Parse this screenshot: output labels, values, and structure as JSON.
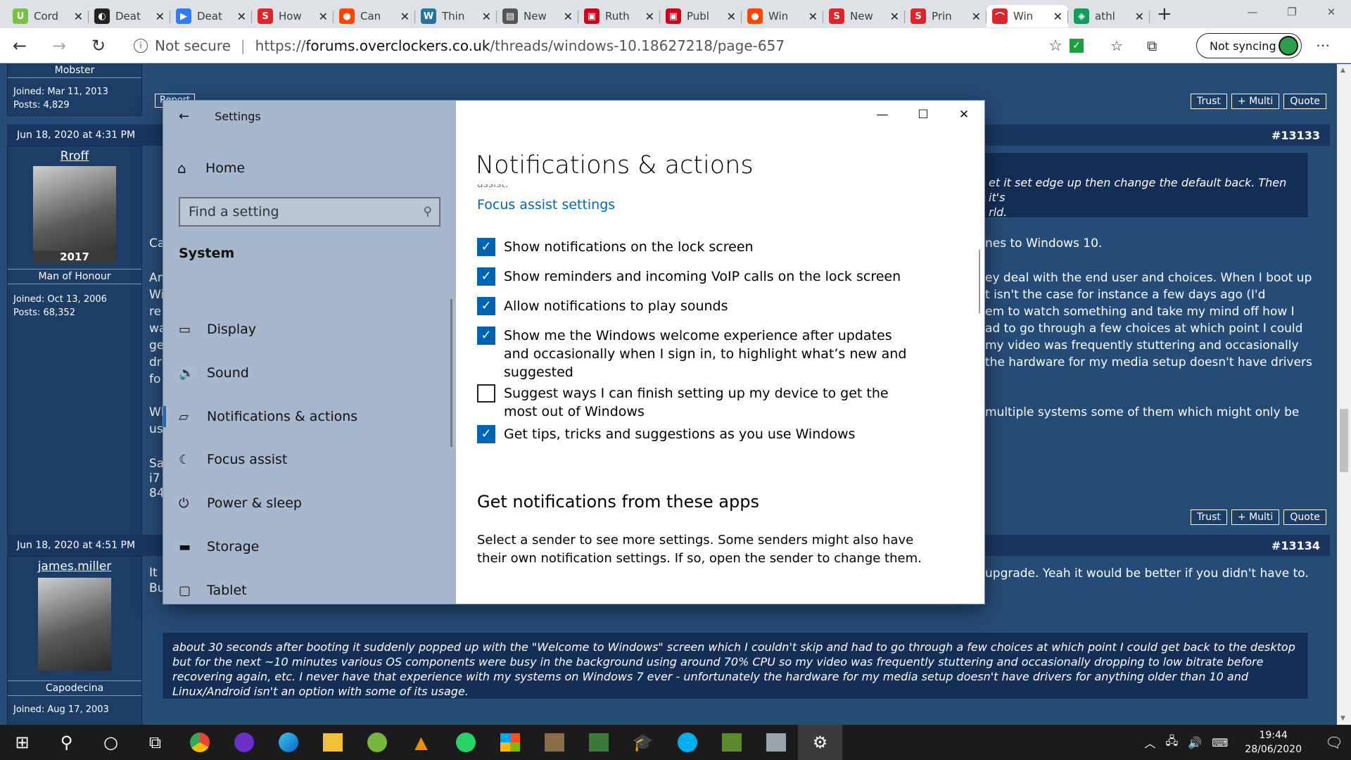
{
  "browser": {
    "tabs": [
      {
        "label": "Cord",
        "icon": "U",
        "color": "#7ac043"
      },
      {
        "label": "Deat",
        "icon": "◐",
        "color": "#222222"
      },
      {
        "label": "Deat",
        "icon": "▶",
        "color": "#2d7cf6"
      },
      {
        "label": "How",
        "icon": "S",
        "color": "#e0242b"
      },
      {
        "label": "Can",
        "icon": "●",
        "color": "#ff4500"
      },
      {
        "label": "Thin",
        "icon": "W",
        "color": "#21759b"
      },
      {
        "label": "New",
        "icon": "▤",
        "color": "#555555"
      },
      {
        "label": "Ruth",
        "icon": "▣",
        "color": "#d0021b"
      },
      {
        "label": "Publ",
        "icon": "▣",
        "color": "#d0021b"
      },
      {
        "label": "Win",
        "icon": "●",
        "color": "#ff4500"
      },
      {
        "label": "New",
        "icon": "S",
        "color": "#e0242b"
      },
      {
        "label": "Prin",
        "icon": "S",
        "color": "#e0242b"
      },
      {
        "label": "Win",
        "icon": "⌒",
        "color": "#e0242b"
      },
      {
        "label": "athl",
        "icon": "◈",
        "color": "#0f9d58"
      }
    ],
    "not_secure": "Not secure",
    "url_prefix": "https://",
    "url_host": "forums.overclockers.co.uk",
    "url_path": "/threads/windows-10.18627218/page-657",
    "sync_label": "Not syncing"
  },
  "forum": {
    "top_user": {
      "rank": "Mobster",
      "joined": "Joined: Mar 11, 2013",
      "posts": "Posts: 4,829",
      "report": "Report"
    },
    "buttons": {
      "trust": "Trust",
      "multi": "+ Multi",
      "quote": "Quote"
    },
    "post1": {
      "date": "Jun 18, 2020 at 4:31 PM",
      "number": "#13133",
      "user": "Rroff",
      "avatar_badge": "2017",
      "rank": "Man of Honour",
      "joined": "Joined: Oct 13, 2006",
      "posts": "Posts: 68,352",
      "quote_text": "et it set edge up then change the default back. Then it's\nrld.",
      "left_fragments": [
        "Ca",
        "An\nWi\nre\nwa\nge\ndr\nfo",
        "Wl\nus",
        "Sa\ni7\n84"
      ],
      "right_lines": [
        "nes to Windows 10.",
        "ey deal with the end user and choices. When I boot up\nt isn't the case for instance a few days ago (I'd\nem to watch something and take my mind off how I\nad to go through a few choices at which point I could\nmy video was frequently stuttering and occasionally\nthe hardware for my media setup doesn't have drivers",
        "multiple systems some of them which might only be"
      ]
    },
    "post2": {
      "date": "Jun 18, 2020 at 4:51 PM",
      "number": "#13134",
      "user": "james.miller",
      "rank": "Capodecina",
      "joined": "Joined: Aug 17, 2003",
      "left_fragment": "It\nBu",
      "right_line": "upgrade. Yeah it would be better if you didn't have to.",
      "quote_text": "about 30 seconds after booting it suddenly popped up with the \"Welcome to Windows\" screen which I couldn't skip and had to go through a few choices at which point I could get back to the desktop but for the next ~10 minutes various OS components were busy in the background using around 70% CPU so my video was frequently stuttering and occasionally dropping to low bitrate before recovering again, etc. I never have that experience with my systems on Windows 7 ever - unfortunately the hardware for my media setup doesn't have drivers for anything older than 10 and Linux/Android isn't an option with some of its usage."
    }
  },
  "settings": {
    "window_title": "Settings",
    "home": "Home",
    "search_placeholder": "Find a setting",
    "section": "System",
    "nav": [
      {
        "label": "Display",
        "icon": "▭"
      },
      {
        "label": "Sound",
        "icon": "🔊"
      },
      {
        "label": "Notifications & actions",
        "icon": "▱"
      },
      {
        "label": "Focus assist",
        "icon": "☾"
      },
      {
        "label": "Power & sleep",
        "icon": "⏻"
      },
      {
        "label": "Storage",
        "icon": "▬"
      },
      {
        "label": "Tablet",
        "icon": "▢"
      }
    ],
    "selected_nav": "Notifications & actions",
    "page_title": "Notifications & actions",
    "cut_text": "assist.",
    "focus_link": "Focus assist settings",
    "checkboxes": [
      {
        "label": "Show notifications on the lock screen",
        "checked": true
      },
      {
        "label": "Show reminders and incoming VoIP calls on the lock screen",
        "checked": true
      },
      {
        "label": "Allow notifications to play sounds",
        "checked": true
      },
      {
        "label": "Show me the Windows welcome experience after updates and occasionally when I sign in, to highlight what’s new and suggested",
        "checked": true
      },
      {
        "label": "Suggest ways I can finish setting up my device to get the most out of Windows",
        "checked": false
      },
      {
        "label": "Get tips, tricks and suggestions as you use Windows",
        "checked": true
      }
    ],
    "apps_heading": "Get notifications from these apps",
    "apps_desc": "Select a sender to see more settings. Some senders might also have their own notification settings. If so, open the sender to change them."
  },
  "taskbar": {
    "time": "19:44",
    "date": "28/06/2020"
  },
  "colors": {
    "accent": "#0063b1",
    "link": "#0066b4",
    "forum_bg": "#274b77"
  }
}
